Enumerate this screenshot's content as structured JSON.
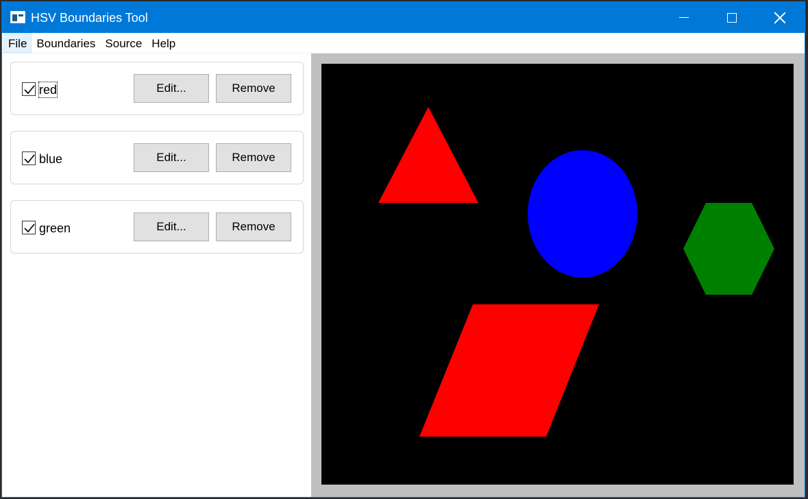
{
  "window": {
    "title": "HSV Boundaries Tool"
  },
  "menu": {
    "items": [
      {
        "label": "File"
      },
      {
        "label": "Boundaries"
      },
      {
        "label": "Source"
      },
      {
        "label": "Help"
      }
    ]
  },
  "boundaries": [
    {
      "name": "red",
      "checked": true,
      "edit_label": "Edit...",
      "remove_label": "Remove"
    },
    {
      "name": "blue",
      "checked": true,
      "edit_label": "Edit...",
      "remove_label": "Remove"
    },
    {
      "name": "green",
      "checked": true,
      "edit_label": "Edit...",
      "remove_label": "Remove"
    }
  ],
  "image": {
    "background": "#000000",
    "shapes": [
      {
        "kind": "triangle",
        "color": "#ff0000"
      },
      {
        "kind": "circle",
        "color": "#0000ff"
      },
      {
        "kind": "hexagon",
        "color": "#008000"
      },
      {
        "kind": "parallelogram",
        "color": "#ff0000"
      }
    ]
  },
  "colors": {
    "titlebar": "#0078d7",
    "button_face": "#e1e1e1"
  }
}
